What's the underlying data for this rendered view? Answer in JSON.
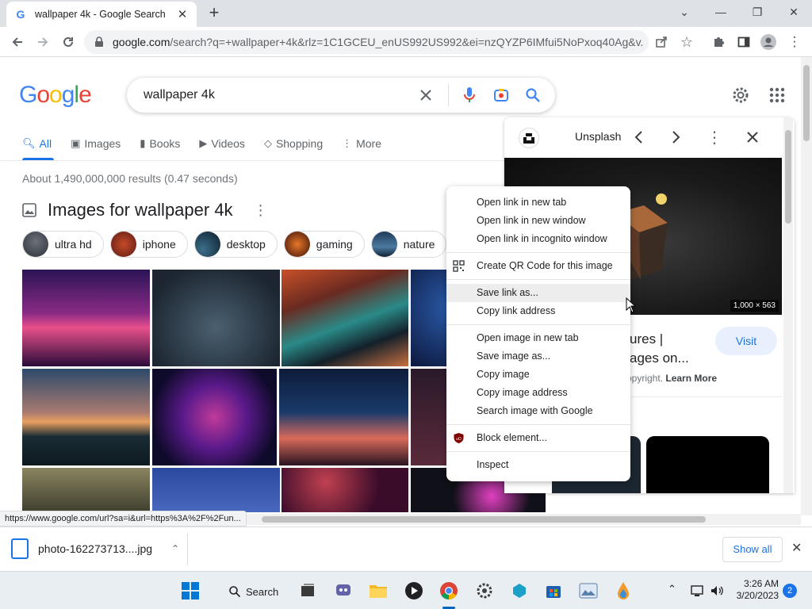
{
  "browser": {
    "tab_title": "wallpaper 4k - Google Search",
    "url_host": "google.com",
    "url_rest": "/search?q=+wallpaper+4k&rlz=1C1GCEU_enUS992US992&ei=nzQYZP6IMfui5NoPxoq40Ag&v...",
    "status_url": "https://www.google.com/url?sa=i&url=https%3A%2F%2Fun..."
  },
  "google": {
    "logo_letters": [
      "G",
      "o",
      "o",
      "g",
      "l",
      "e"
    ],
    "query": "wallpaper 4k",
    "tabs": [
      {
        "label": "All",
        "icon": "search-icon"
      },
      {
        "label": "Images",
        "icon": "image-icon"
      },
      {
        "label": "Books",
        "icon": "book-icon"
      },
      {
        "label": "Videos",
        "icon": "video-icon"
      },
      {
        "label": "Shopping",
        "icon": "tag-icon"
      },
      {
        "label": "More",
        "icon": "more-vert-icon"
      }
    ],
    "results_count": "About 1,490,000,000 results (0.47 seconds)",
    "images_header": "Images for wallpaper 4k",
    "chips": [
      "ultra hd",
      "iphone",
      "desktop",
      "gaming",
      "nature"
    ]
  },
  "panel": {
    "source": "Unsplash",
    "image_dims": "1,000 × 563",
    "title_line1": "ures |",
    "title_line2": "ages on...",
    "visit": "Visit",
    "copyright": "opyright.",
    "learn_more": "Learn More"
  },
  "context_menu": {
    "open_new_tab": "Open link in new tab",
    "open_new_window": "Open link in new window",
    "open_incognito": "Open link in incognito window",
    "create_qr": "Create QR Code for this image",
    "save_link": "Save link as...",
    "copy_link": "Copy link address",
    "open_image_tab": "Open image in new tab",
    "save_image": "Save image as...",
    "copy_image": "Copy image",
    "copy_image_address": "Copy image address",
    "search_image": "Search image with Google",
    "block_element": "Block element...",
    "inspect": "Inspect"
  },
  "downloads": {
    "filename": "photo-162273713....jpg",
    "show_all": "Show all"
  },
  "taskbar": {
    "search_label": "Search",
    "time": "3:26 AM",
    "date": "3/20/2023",
    "notification_count": "2"
  },
  "colors": {
    "accent": "#1a73e8",
    "tabstrip": "#dee1e6"
  }
}
